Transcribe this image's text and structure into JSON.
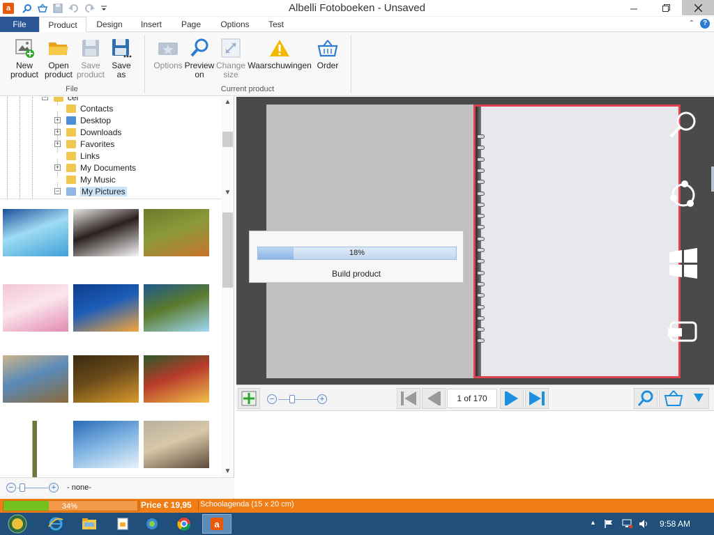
{
  "window": {
    "title": "Albelli Fotoboeken - Unsaved"
  },
  "ribbon": {
    "tabs": [
      "File",
      "Product",
      "Design",
      "Insert",
      "Page",
      "Options",
      "Test"
    ],
    "groups": [
      {
        "label": "File",
        "buttons": [
          {
            "label": "New\nproduct",
            "icon": "new-product-icon",
            "enabled": true
          },
          {
            "label": "Open\nproduct",
            "icon": "open-folder-icon",
            "enabled": true
          },
          {
            "label": "Save\nproduct",
            "icon": "save-icon",
            "enabled": false
          },
          {
            "label": "Save\nas",
            "icon": "save-as-icon",
            "enabled": true
          }
        ]
      },
      {
        "label": "Current product",
        "buttons": [
          {
            "label": "Options",
            "icon": "options-icon",
            "enabled": false
          },
          {
            "label": "Preview\non",
            "icon": "magnifier-icon",
            "enabled": true
          },
          {
            "label": "Change\nsize",
            "icon": "resize-icon",
            "enabled": false
          },
          {
            "label": "Waarschuwingen",
            "icon": "warning-icon",
            "enabled": true
          },
          {
            "label": "Order",
            "icon": "basket-icon",
            "enabled": true
          }
        ]
      }
    ]
  },
  "tree": {
    "partial_label": "cel",
    "items": [
      {
        "label": "Contacts",
        "expander": ""
      },
      {
        "label": "Desktop",
        "expander": "+"
      },
      {
        "label": "Downloads",
        "expander": "+"
      },
      {
        "label": "Favorites",
        "expander": "+"
      },
      {
        "label": "Links",
        "expander": ""
      },
      {
        "label": "My Documents",
        "expander": "+"
      },
      {
        "label": "My Music",
        "expander": ""
      },
      {
        "label": "My Pictures",
        "expander": "−",
        "selected": true
      }
    ]
  },
  "thumbnails": [
    {
      "name": "dolphins",
      "colors": [
        "#1b4f9c",
        "#3fa0d8",
        "#9fdcf2"
      ]
    },
    {
      "name": "white-lion",
      "colors": [
        "#e8e6e2",
        "#f8f8f6",
        "#2a2020"
      ]
    },
    {
      "name": "fox",
      "colors": [
        "#6b7a2a",
        "#c8742c",
        "#8a9a3a"
      ]
    },
    {
      "name": "cherry-blossom",
      "colors": [
        "#f3c5d6",
        "#e38ab0",
        "#fbe6ee"
      ]
    },
    {
      "name": "sunset-sea",
      "colors": [
        "#0d3d8a",
        "#f7a53a",
        "#1d5db8"
      ]
    },
    {
      "name": "waterfall",
      "colors": [
        "#1e5a8e",
        "#9fd8f5",
        "#5a7a2c"
      ]
    },
    {
      "name": "riverside-city",
      "colors": [
        "#c9b58a",
        "#8a6a3a",
        "#5a8ab8"
      ]
    },
    {
      "name": "autumn-forest",
      "colors": [
        "#3a2a10",
        "#d89a2a",
        "#6a4a1a"
      ]
    },
    {
      "name": "tree-sunlight",
      "colors": [
        "#2a5a2a",
        "#f0c04a",
        "#b83a2a"
      ]
    },
    {
      "name": "wooden-post",
      "colors": [
        "#ffffff",
        "#6a7a3a",
        "#ffffff"
      ]
    },
    {
      "name": "glacier",
      "colors": [
        "#2a6ab8",
        "#e8f2fa",
        "#7ab0e0"
      ]
    },
    {
      "name": "birds",
      "colors": [
        "#b8b0a0",
        "#5a4a3a",
        "#d8c8a8"
      ]
    }
  ],
  "left_footer": {
    "label": "- none-"
  },
  "progress": {
    "percent": 18,
    "text": "18%",
    "label": "Build product"
  },
  "navigation": {
    "page_indicator": "1 of 170"
  },
  "statusbar": {
    "progress": {
      "percent": 34,
      "text": "34%"
    },
    "price": "Price € 19,95",
    "product": "Schoolagenda (15 x 20 cm)"
  },
  "taskbar": {
    "clock": "9:58 AM"
  },
  "colors": {
    "accent": "#2b5797",
    "status_orange": "#f07d16",
    "status_green": "#74c01f",
    "page_border_red": "#e04350",
    "taskbar": "#1f4f7a"
  }
}
